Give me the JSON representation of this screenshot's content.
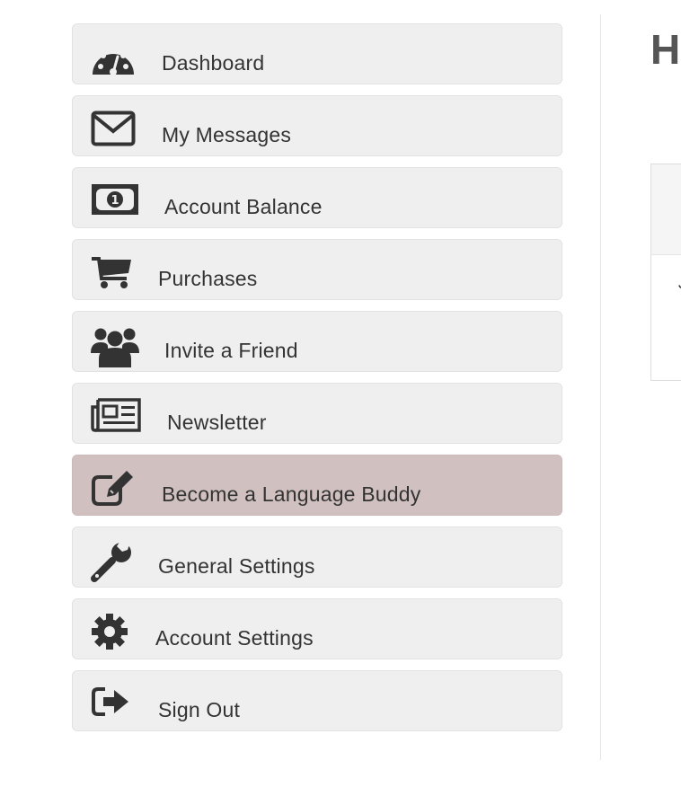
{
  "menu": {
    "items": [
      {
        "label": "Dashboard",
        "icon": "dashboard-icon"
      },
      {
        "label": "My Messages",
        "icon": "envelope-icon"
      },
      {
        "label": "Account Balance",
        "icon": "money-icon"
      },
      {
        "label": "Purchases",
        "icon": "cart-icon"
      },
      {
        "label": "Invite a Friend",
        "icon": "users-icon"
      },
      {
        "label": "Newsletter",
        "icon": "newspaper-icon"
      },
      {
        "label": "Become a Language Buddy",
        "icon": "edit-icon",
        "active": true
      },
      {
        "label": "General Settings",
        "icon": "wrench-icon"
      },
      {
        "label": "Account Settings",
        "icon": "gear-icon"
      },
      {
        "label": "Sign Out",
        "icon": "sign-out-icon"
      }
    ],
    "active_color": "#d0c1c0",
    "item_color": "#efefef"
  },
  "main": {
    "heading": "H",
    "panel_text": "J"
  }
}
